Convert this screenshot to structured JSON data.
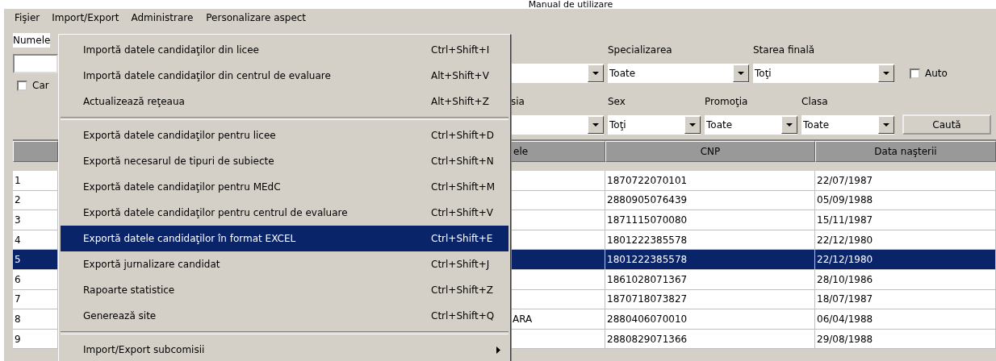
{
  "document_title": "Manual de utilizare",
  "menu_bar": [
    {
      "label": "Fişier",
      "selected": false
    },
    {
      "label": "Import/Export",
      "selected": true
    },
    {
      "label": "Administrare",
      "selected": false
    },
    {
      "label": "Personalizare aspect",
      "selected": false
    }
  ],
  "filters": {
    "name_label": "Numele",
    "left_checkbox": {
      "label": "Car",
      "checked": false
    },
    "row_1": [
      {
        "label": "Specializarea",
        "value": "Toate"
      },
      {
        "label": "Starea finală",
        "value": "Toţi"
      }
    ],
    "auto_checkbox": {
      "label": "Auto",
      "checked": false
    },
    "row_2": [
      {
        "label": "sia"
      },
      {
        "label": "Sex",
        "value": "Toţi"
      },
      {
        "label": "Promoţia",
        "value": "Toate"
      },
      {
        "label": "Clasa",
        "value": "Toate"
      }
    ],
    "search_button": "Caută"
  },
  "table": {
    "columns": [
      "ele",
      "CNP",
      "Data naşterii"
    ],
    "rows": [
      {
        "number": "1",
        "cnp": "1870722070101",
        "birth_date": "22/07/1987",
        "selected": false
      },
      {
        "number": "2",
        "cnp": "2880905076439",
        "birth_date": "05/09/1988",
        "selected": false
      },
      {
        "number": "3",
        "cnp": "1871115070080",
        "birth_date": "15/11/1987",
        "selected": false
      },
      {
        "number": "4",
        "cnp": "1801222385578",
        "birth_date": "22/12/1980",
        "selected": false
      },
      {
        "number": "5",
        "cnp": "1801222385578",
        "birth_date": "22/12/1980",
        "selected": true
      },
      {
        "number": "6",
        "cnp": "1861028071367",
        "birth_date": "28/10/1986",
        "selected": false
      },
      {
        "number": "7",
        "cnp": "1870718073827",
        "birth_date": "18/07/1987",
        "selected": false
      },
      {
        "number": "8",
        "column_2": "ARA",
        "cnp": "2880406070010",
        "birth_date": "06/04/1988",
        "selected": false
      },
      {
        "number": "9",
        "cnp": "2880829071366",
        "birth_date": "29/08/1988",
        "selected": false
      }
    ]
  },
  "dropdown_menu": [
    {
      "kind": "item",
      "label": "Importă datele candidaţilor din licee",
      "shortcut": "Ctrl+Shift+I",
      "selected": false
    },
    {
      "kind": "item",
      "label": "Importă datele candidaţilor din centrul de evaluare",
      "shortcut": "Alt+Shift+V",
      "selected": false
    },
    {
      "kind": "item",
      "label": "Actualizează reţeaua",
      "shortcut": "Alt+Shift+Z",
      "selected": false
    },
    {
      "kind": "separator"
    },
    {
      "kind": "item",
      "label": "Exportă datele candidaţilor pentru licee",
      "shortcut": "Ctrl+Shift+D",
      "selected": false
    },
    {
      "kind": "item",
      "label": "Exportă necesarul de tipuri de subiecte",
      "shortcut": "Ctrl+Shift+N",
      "selected": false
    },
    {
      "kind": "item",
      "label": "Exportă datele candidaţilor pentru MEdC",
      "shortcut": "Ctrl+Shift+M",
      "selected": false
    },
    {
      "kind": "item",
      "label": "Exportă datele candidaţilor pentru centrul de evaluare",
      "shortcut": "Ctrl+Shift+V",
      "selected": false
    },
    {
      "kind": "item",
      "label": "Exportă datele candidaţilor în format EXCEL",
      "shortcut": "Ctrl+Shift+E",
      "selected": true
    },
    {
      "kind": "item",
      "label": "Exportă jurnalizare candidat",
      "shortcut": "Ctrl+Shift+J",
      "selected": false
    },
    {
      "kind": "item",
      "label": "Rapoarte statistice",
      "shortcut": "Ctrl+Shift+Z",
      "selected": false
    },
    {
      "kind": "item",
      "label": "Generează site",
      "shortcut": "Ctrl+Shift+Q",
      "selected": false
    },
    {
      "kind": "separator"
    },
    {
      "kind": "submenu",
      "label": "Import/Export subcomisii",
      "selected": false
    }
  ]
}
